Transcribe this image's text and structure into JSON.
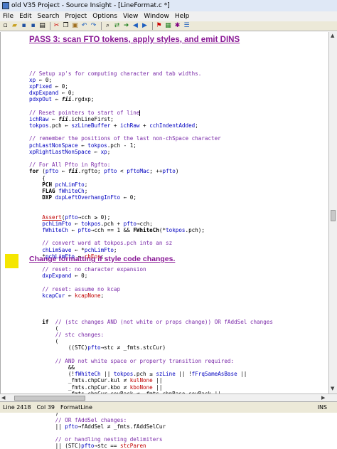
{
  "window": {
    "title": "old V35 Project - Source Insight - [LineFormat.c *]"
  },
  "menu": [
    "File",
    "Edit",
    "Search",
    "Project",
    "Options",
    "View",
    "Window",
    "Help"
  ],
  "toolbar": {
    "icons": [
      "new-file-icon",
      "open-icon",
      "save-icon",
      "save-all-icon",
      "print-icon",
      "cut-icon",
      "copy-icon",
      "paste-icon",
      "undo-icon",
      "redo-icon",
      "search-icon",
      "replace-icon",
      "jump-icon",
      "back-icon",
      "forward-icon",
      "bookmark-icon",
      "project-icon",
      "symbol-icon",
      "browse-icon"
    ]
  },
  "headings": {
    "pass3": "PASS 3: scan FTO tokens, apply styles, and emit DINS",
    "change": "Change formatting if style code changes."
  },
  "code": [
    "",
    "",
    "",
    "// Setup xp's for computing character and tab widths.",
    "xp ← 0;",
    "xpFixed ← 0;",
    "dxpExpand ← 0;",
    "pdxpOut ← fii.rgdxp;",
    "",
    "// Reset pointers to start of line",
    "ichRaw ← fii.ichLineFirst;",
    "tokpos.pch ← szLineBuffer + ichRaw + cchIndentAdded;",
    "",
    "// remember the positions of the last non-chSpace character",
    "pchLastNonSpace ← tokpos.pch - 1;",
    "xpRightLastNonSpace ← xp;",
    "",
    "// For All Pfto in Rgfto:",
    "for (pfto ← fii.rgfto; pfto < pftoMac; ++pfto)",
    "    {",
    "    PCH pchLimFto;",
    "    FLAG fWhiteCh;",
    "    DXP dxpLeftOverhangInFto ← 0;",
    "",
    "",
    "    Assert(pfto→cch ≥ 0);",
    "    pchLimFto ← tokpos.pch + pfto→cch;",
    "    fWhiteCh ← pfto→cch == 1 && FWhiteCh(*tokpos.pch);",
    "",
    "    // convert word at tokpos.pch into an sz",
    "    chLimSave ← *pchLimFto;",
    "    *pchLimFto ← chEos;",
    "",
    "    // reset: no character expansion",
    "    dxpExpand ← 0;",
    "",
    "    // reset: assume no kcap",
    "    kcapCur ← kcapNone;",
    "",
    "",
    "",
    "    if  // (stc changes AND (not white or props change)) OR fAddSel changes",
    "        (",
    "        // stc changes:",
    "        (",
    "            ((STC)pfto→stc ≠ _fmts.stcCur)",
    "",
    "        // AND not white space or property transition required:",
    "            &&",
    "            (!fWhiteCh || tokpos.pch ≤ szLine || !fFrqSameAsBase ||",
    "            _fmts.chpCur.kul ≠ kulNone ||",
    "            _fmts.chpCur.kbo ≠ kboNone ||",
    "            _fmts.chpCur.covBack ≠ _fmts.chpBase.covBack ||",
    "            _fmts.fVisiTabs || _fmts.fVisiSpaces",
    "            )",
    "        )",
    "        // OR fAddSel changes:",
    "        || pfto→fAddSel ≠ _fmts.fAddSelCur",
    "",
    "        // or handling nesting delimiters",
    "        || (STC)pfto→stc == stcParen"
  ],
  "status": {
    "line": "Line 2418",
    "col": "Col 39",
    "func": "FormatLine",
    "mode": "INS"
  }
}
